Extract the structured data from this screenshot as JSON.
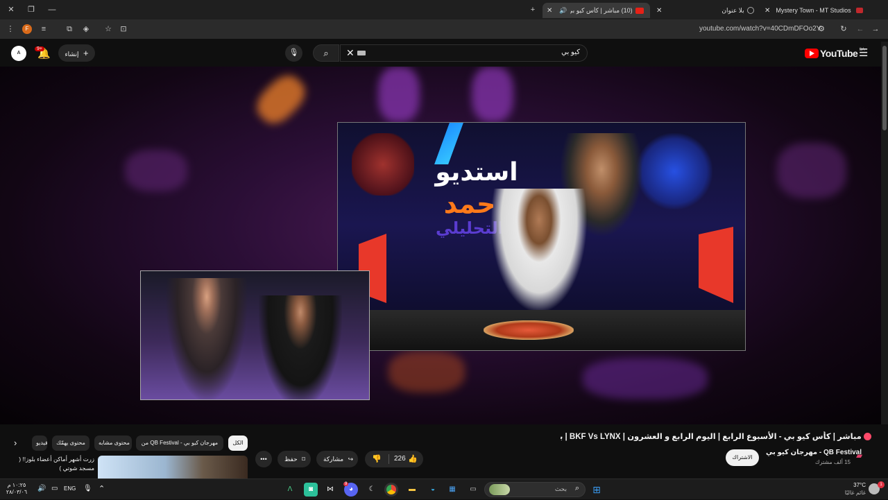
{
  "browser": {
    "tabs": [
      {
        "label": "Mystery Town - MT Studios | M"
      },
      {
        "label": "بلا عنوان"
      },
      {
        "label": "(10) مباشر | كأس كيو بي -"
      }
    ],
    "new_tab": "+",
    "url": "youtube.com/watch?v=40CDmDFOo2Y",
    "profile_initial": "F"
  },
  "youtube": {
    "logo_text": "YouTube",
    "region": "SA",
    "search_value": "كيو بي",
    "create_label": "إنشاء",
    "notif_count": "9+"
  },
  "video_overlay": {
    "studio_line1": "استديو",
    "studio_line2": "حمد",
    "studio_line3": "التحليلي"
  },
  "video": {
    "title": "مباشر | كأس كيو بي - الأسبوع الرابع | اليوم الرابع و العشرون | BKF Vs LYNX | بوليفارد سيتي",
    "channel": "مهرجان كيو بي - QB Festival",
    "subscribers": "15 ألف مشترك",
    "subscribe_label": "الاشتراك",
    "likes": "226",
    "share_label": "مشاركة",
    "save_label": "حفظ"
  },
  "chips": [
    {
      "label": "الكل",
      "selected": true
    },
    {
      "label": "من QB Festival - مهرجان كيو بي"
    },
    {
      "label": "محتوى مشابه"
    },
    {
      "label": "محتوى يهمّك"
    },
    {
      "label": "فيديو"
    }
  ],
  "recommendation": {
    "title": "زرت أشهر أماكن أعضاء بلوز!! ( مسجد شوتي )"
  },
  "taskbar": {
    "search_placeholder": "بحث",
    "lang": "ENG",
    "time": "١٠:٢٥ م",
    "date": "٢٨/٠٣/٠٦",
    "weather_temp": "37°C",
    "weather_desc": "غائم غالبًا",
    "weather_badge": "1",
    "discord_badge": "9"
  }
}
